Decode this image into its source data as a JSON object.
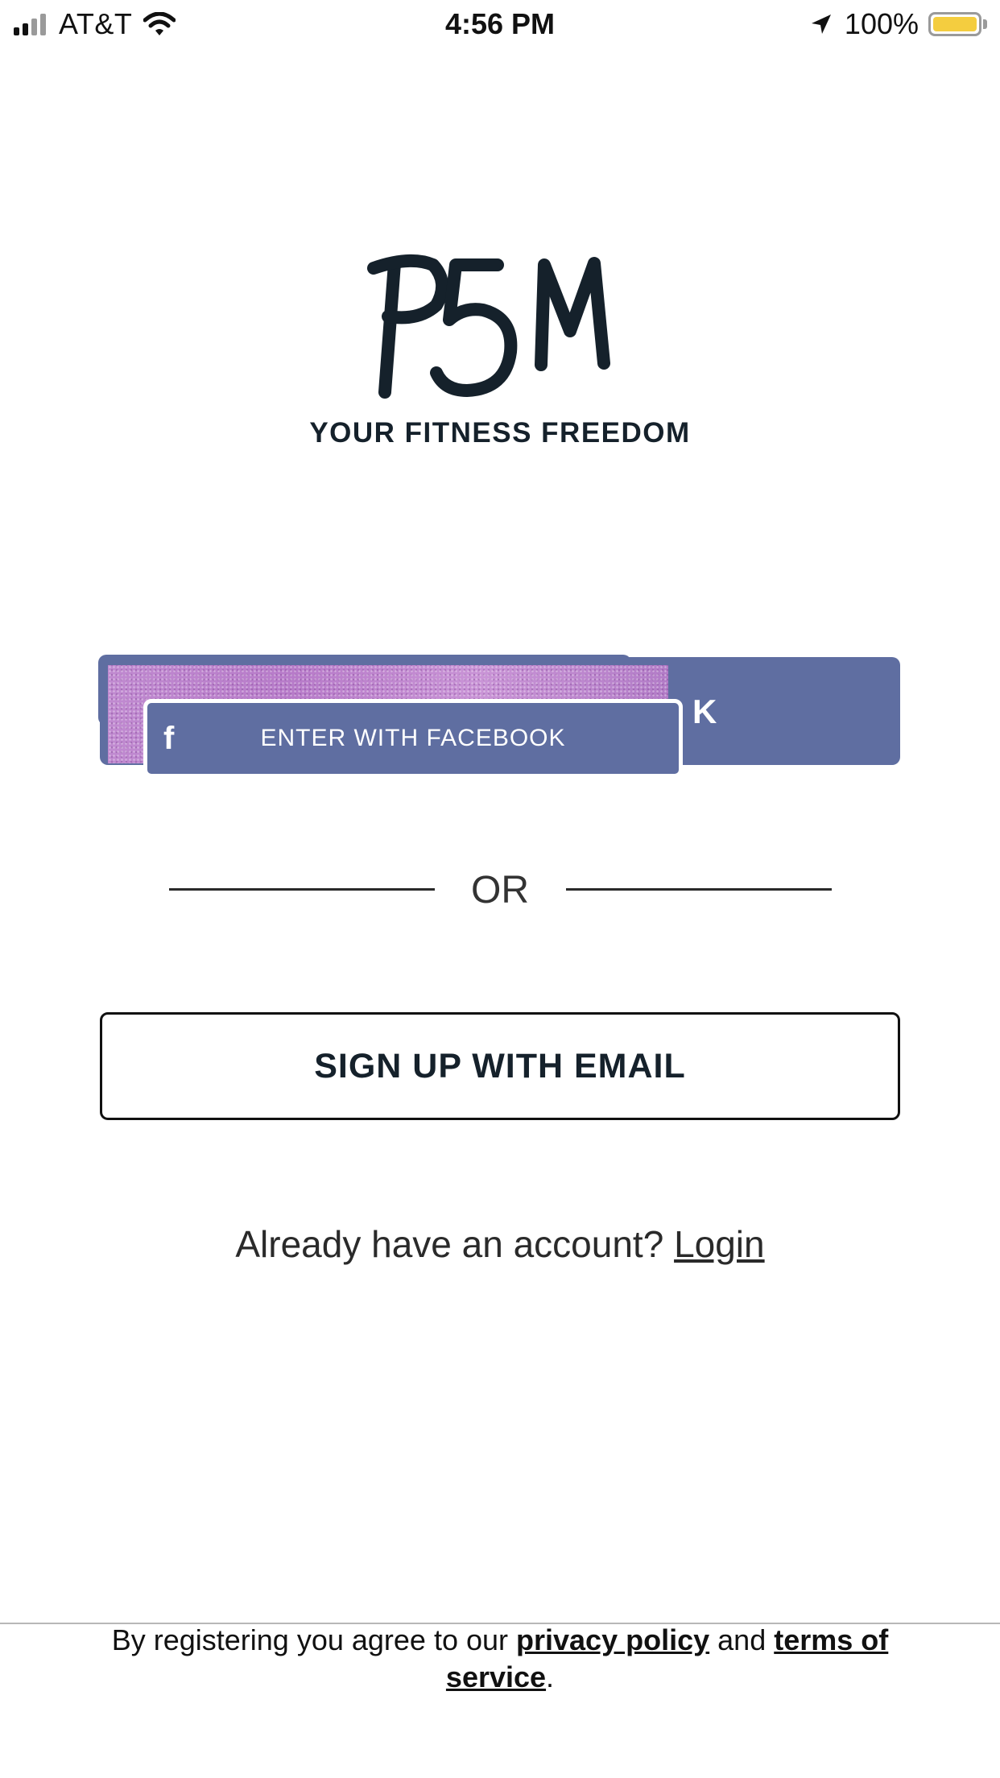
{
  "status_bar": {
    "carrier": "AT&T",
    "time": "4:56 PM",
    "battery": "100%",
    "battery_color": "#f4cd3f"
  },
  "brand": {
    "logo_text": "P5M",
    "tagline": "YOUR FITNESS FREEDOM",
    "color": "#15212b"
  },
  "facebook": {
    "label": "ENTER WITH FACEBOOK",
    "icon": "facebook-f-icon",
    "ghost_text": "K",
    "color": "#5f6ea1"
  },
  "divider": {
    "label": "OR"
  },
  "email_signup": {
    "label": "SIGN UP WITH EMAIL"
  },
  "login": {
    "prompt": "Already have an account?",
    "link": "Login"
  },
  "footer": {
    "prefix": "By registering you agree to our",
    "privacy": "privacy policy",
    "and": "and",
    "terms": "terms of service",
    "suffix": "."
  }
}
